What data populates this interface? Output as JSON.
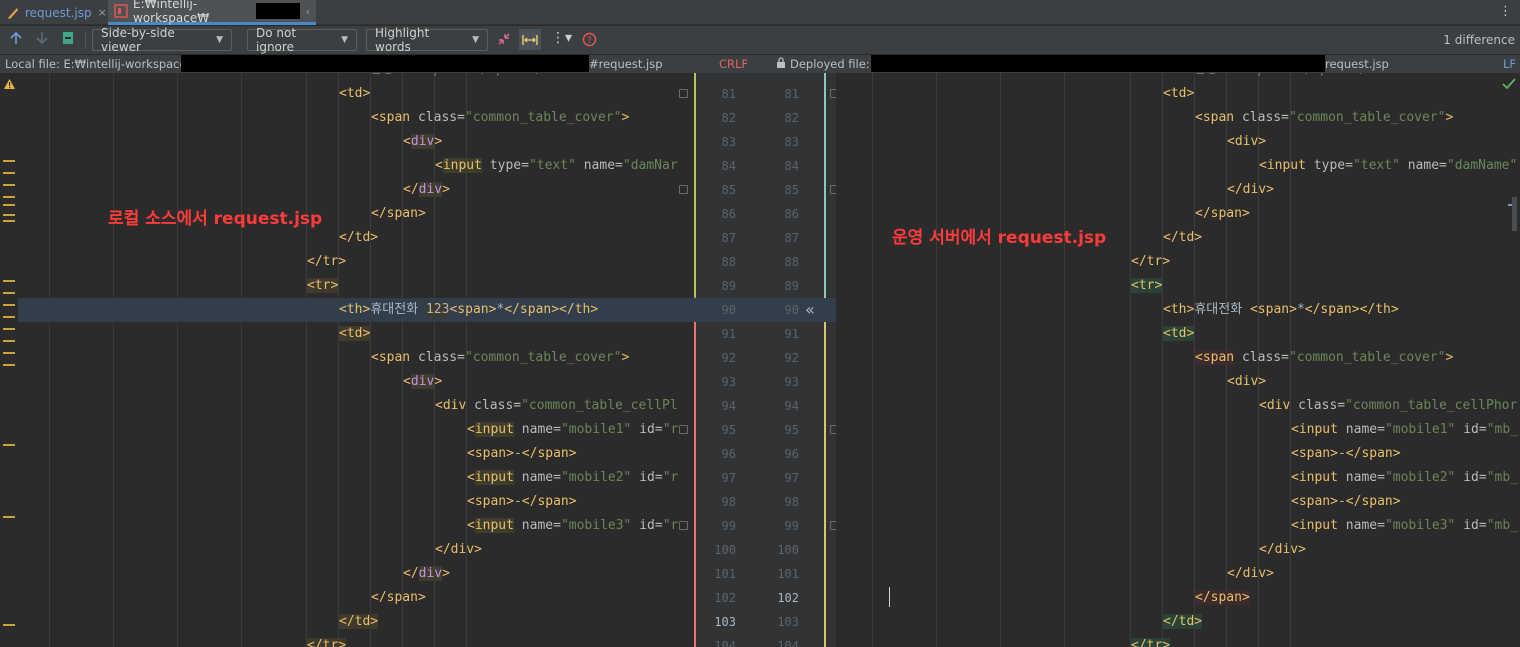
{
  "tabs": [
    {
      "label": "request.jsp",
      "close": "×"
    },
    {
      "label": "E:₩intellij-workspace₩",
      "close": "‹"
    }
  ],
  "toolbar": {
    "viewer": "Side-by-side viewer",
    "ignore": "Do not ignore",
    "highlight": "Highlight words",
    "difference_count": "1 difference",
    "accent": "#7aa3d9"
  },
  "fileinfo": {
    "local_label": "Local file: E:₩intellij-workspace₩",
    "local_suffix": "#request.jsp",
    "left_eol": "CRLF",
    "deployed_label": "Deployed file: /",
    "deployed_suffix": "request.jsp",
    "right_eol": "LF"
  },
  "annotations": {
    "left": "로컬 소스에서 request.jsp",
    "right": "운영 서버에서 request.jsp"
  },
  "line_numbers": [
    "81",
    "82",
    "83",
    "84",
    "85",
    "86",
    "87",
    "88",
    "89",
    "90",
    "91",
    "92",
    "93",
    "94",
    "95",
    "96",
    "97",
    "98",
    "99",
    "100",
    "101",
    "102",
    "103",
    "104"
  ],
  "icons": {
    "up": "arrow-up-icon",
    "down": "arrow-down-icon",
    "lock": "lock-icon",
    "warning": "warning-icon",
    "check": "check-icon",
    "help": "help-icon"
  },
  "colors": {
    "tag": "#e8bf6a",
    "attr": "#bababa",
    "value": "#6a8759",
    "highlight_line": "#323e4b",
    "annotation": "#ff3b3b"
  }
}
